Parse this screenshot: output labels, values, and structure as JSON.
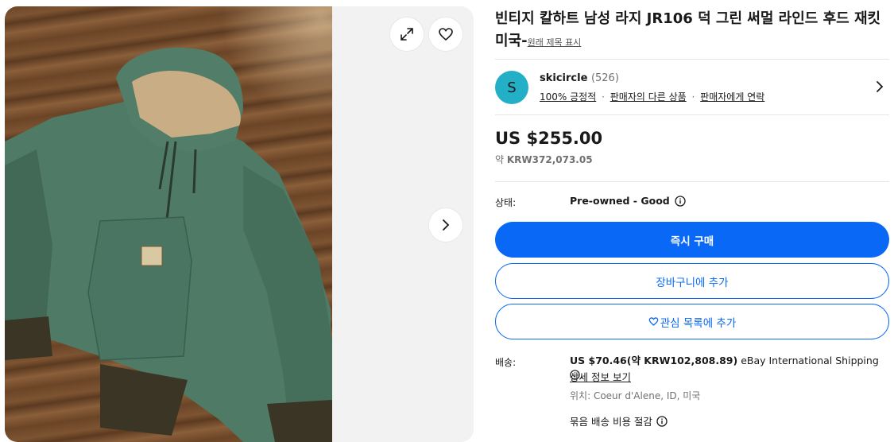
{
  "gallery": {
    "expand_icon": "expand-icon",
    "heart_icon": "heart-icon",
    "next_icon": "chevron-right-icon"
  },
  "listing": {
    "title": "빈티지 칼하트 남성 라지 JR106 덕 그린 써멀 라인드 후드 재킷 미국-",
    "show_original_title": "원래 제목 표시"
  },
  "seller": {
    "avatar_letter": "S",
    "name": "skicircle",
    "feedback_count": "(526)",
    "positive": "100% 긍정적",
    "other_items": "판매자의 다른 상품",
    "contact": "판매자에게 연락",
    "separator": "·"
  },
  "price": {
    "main": "US $255.00",
    "approx_prefix": "약",
    "approx_value": "KRW372,073.05"
  },
  "condition": {
    "label": "상태:",
    "value": "Pre-owned - Good"
  },
  "buttons": {
    "buy_now": "즉시 구매",
    "add_to_cart": "장바구니에 추가",
    "add_to_watchlist": "관심 목록에 추가"
  },
  "shipping": {
    "label": "배송:",
    "cost": "US $70.46(약 KRW102,808.89)",
    "service": "eBay International Shipping",
    "period": ".",
    "details_link": "상세 정보 보기",
    "location": "위치: Coeur d'Alene, ID, 미국",
    "combine": "묶음 배송 비용 절감"
  },
  "colors": {
    "accent": "#0968f6",
    "avatar_bg": "#23b0c7",
    "jacket": "#4f7a66"
  }
}
